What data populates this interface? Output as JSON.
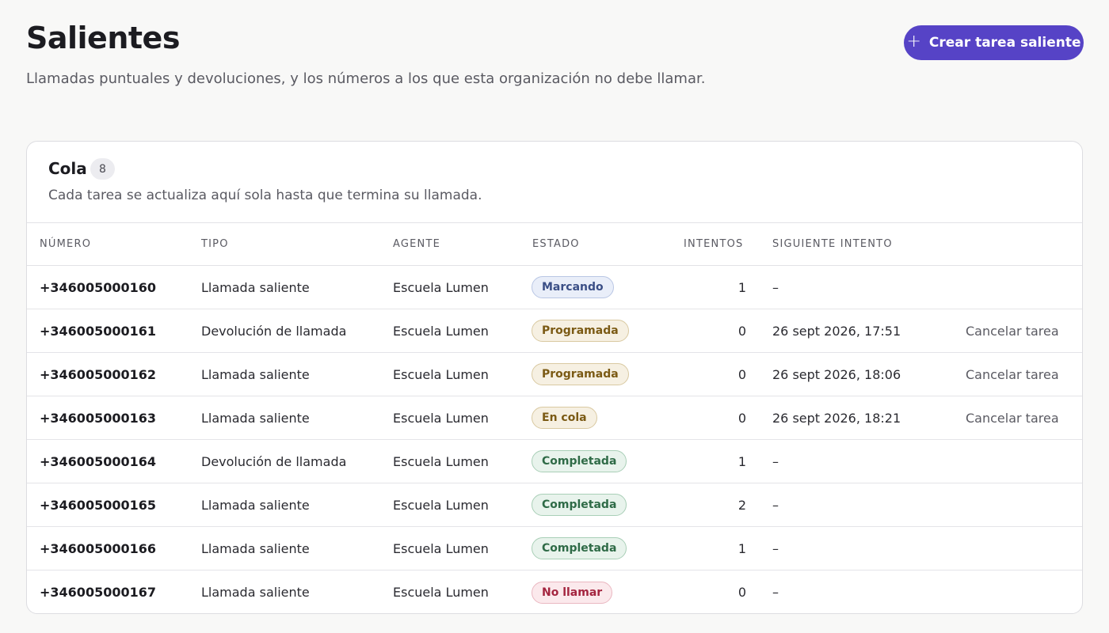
{
  "header": {
    "title": "Salientes",
    "subtitle": "Llamadas puntuales y devoluciones, y los números a los que esta organización no debe llamar.",
    "create_button_label": "Crear tarea saliente",
    "create_button_icon": "plus-icon",
    "accent_color": "#5643c6"
  },
  "queue": {
    "title": "Cola",
    "count": "8",
    "description": "Cada tarea se actualiza aquí sola hasta que termina su llamada.",
    "columns": {
      "number": "NÚMERO",
      "type": "TIPO",
      "agent": "AGENTE",
      "status": "ESTADO",
      "attempts": "INTENTOS",
      "next_attempt": "SIGUIENTE INTENTO"
    },
    "rows": [
      {
        "number": "+346005000160",
        "type": "Llamada saliente",
        "agent": "Escuela Lumen",
        "status": "Marcando",
        "status_color": "blue",
        "attempts": "1",
        "next_attempt": "–",
        "action": ""
      },
      {
        "number": "+346005000161",
        "type": "Devolución de llamada",
        "agent": "Escuela Lumen",
        "status": "Programada",
        "status_color": "amber",
        "attempts": "0",
        "next_attempt": "26 sept 2026, 17:51",
        "action": "Cancelar tarea"
      },
      {
        "number": "+346005000162",
        "type": "Llamada saliente",
        "agent": "Escuela Lumen",
        "status": "Programada",
        "status_color": "amber",
        "attempts": "0",
        "next_attempt": "26 sept 2026, 18:06",
        "action": "Cancelar tarea"
      },
      {
        "number": "+346005000163",
        "type": "Llamada saliente",
        "agent": "Escuela Lumen",
        "status": "En cola",
        "status_color": "amber",
        "attempts": "0",
        "next_attempt": "26 sept 2026, 18:21",
        "action": "Cancelar tarea"
      },
      {
        "number": "+346005000164",
        "type": "Devolución de llamada",
        "agent": "Escuela Lumen",
        "status": "Completada",
        "status_color": "green",
        "attempts": "1",
        "next_attempt": "–",
        "action": ""
      },
      {
        "number": "+346005000165",
        "type": "Llamada saliente",
        "agent": "Escuela Lumen",
        "status": "Completada",
        "status_color": "green",
        "attempts": "2",
        "next_attempt": "–",
        "action": ""
      },
      {
        "number": "+346005000166",
        "type": "Llamada saliente",
        "agent": "Escuela Lumen",
        "status": "Completada",
        "status_color": "green",
        "attempts": "1",
        "next_attempt": "–",
        "action": ""
      },
      {
        "number": "+346005000167",
        "type": "Llamada saliente",
        "agent": "Escuela Lumen",
        "status": "No llamar",
        "status_color": "red",
        "attempts": "0",
        "next_attempt": "–",
        "action": ""
      }
    ]
  }
}
